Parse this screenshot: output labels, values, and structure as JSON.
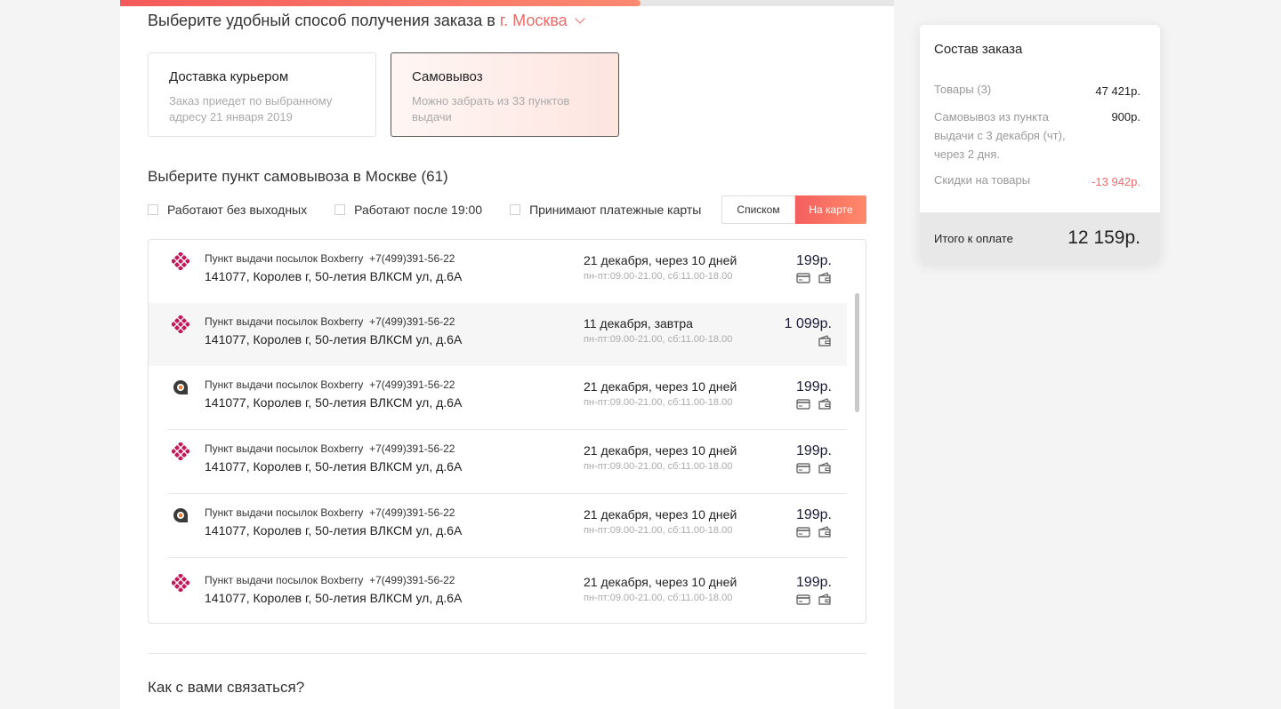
{
  "progress": {
    "fraction": 0.672
  },
  "header": {
    "prefix": "Выберите удобный способ получения заказа в",
    "city": "г. Москва"
  },
  "delivery_options": [
    {
      "title": "Доставка курьером",
      "desc": "Заказ приедет по выбранному адресу 21 января 2019",
      "selected": false
    },
    {
      "title": "Самовывоз",
      "desc": "Можно забрать из 33 пунктов выдачи",
      "selected": true
    }
  ],
  "pickup": {
    "title": "Выберите пункт самовывоза в Москве (61)",
    "filters": [
      "Работают без выходных",
      "Работают после 19:00",
      "Принимают платежные карты"
    ],
    "view_list": "Списком",
    "view_map": "На карте",
    "points": [
      {
        "logo": "boxberry-logo-icon",
        "name": "Пункт выдачи посылок Boxberry",
        "phone": "+7(499)391-56-22",
        "address": "141077, Королев г, 50-летия ВЛКСМ ул, д.6А",
        "date": "21 декабря, через 10 дней",
        "hours": "пн-пт:09.00-21.00, сб:11.00-18.00",
        "price": "199р.",
        "card": true,
        "wallet": true,
        "highlighted": false
      },
      {
        "logo": "boxberry-logo-icon",
        "name": "Пункт выдачи посылок Boxberry",
        "phone": "+7(499)391-56-22",
        "address": "141077, Королев г, 50-летия ВЛКСМ ул, д.6А",
        "date": "11 декабря, завтра",
        "hours": "пн-пт:09.00-21.00, сб:11.00-18.00",
        "price": "1 099р.",
        "card": false,
        "wallet": true,
        "highlighted": true
      },
      {
        "logo": "pickpoint-logo-icon",
        "name": "Пункт выдачи посылок Boxberry",
        "phone": "+7(499)391-56-22",
        "address": "141077, Королев г, 50-летия ВЛКСМ ул, д.6А",
        "date": "21 декабря, через 10 дней",
        "hours": "пн-пт:09.00-21.00, сб:11.00-18.00",
        "price": "199р.",
        "card": true,
        "wallet": true,
        "highlighted": false
      },
      {
        "logo": "boxberry-logo-icon",
        "name": "Пункт выдачи посылок Boxberry",
        "phone": "+7(499)391-56-22",
        "address": "141077, Королев г, 50-летия ВЛКСМ ул, д.6А",
        "date": "21 декабря, через 10 дней",
        "hours": "пн-пт:09.00-21.00, сб:11.00-18.00",
        "price": "199р.",
        "card": true,
        "wallet": true,
        "highlighted": false
      },
      {
        "logo": "pickpoint-logo-icon",
        "name": "Пункт выдачи посылок Boxberry",
        "phone": "+7(499)391-56-22",
        "address": "141077, Королев г, 50-летия ВЛКСМ ул, д.6А",
        "date": "21 декабря, через 10 дней",
        "hours": "пн-пт:09.00-21.00, сб:11.00-18.00",
        "price": "199р.",
        "card": true,
        "wallet": true,
        "highlighted": false
      },
      {
        "logo": "boxberry-logo-icon",
        "name": "Пункт выдачи посылок Boxberry",
        "phone": "+7(499)391-56-22",
        "address": "141077, Королев г, 50-летия ВЛКСМ ул, д.6А",
        "date": "21 декабря, через 10 дней",
        "hours": "пн-пт:09.00-21.00, сб:11.00-18.00",
        "price": "199р.",
        "card": true,
        "wallet": true,
        "highlighted": false
      }
    ]
  },
  "contact": {
    "title": "Как с вами связаться?"
  },
  "summary": {
    "title": "Состав заказа",
    "lines": [
      {
        "label": "Товары (3)",
        "value": "47 421р.",
        "negative": false
      },
      {
        "label": "Самовывоз из пункта выдачи с 3 декабря (чт), через 2 дня.",
        "value": "900р.",
        "negative": false
      },
      {
        "label": "Скидки на товары",
        "value": "-13 942р.",
        "negative": true
      }
    ],
    "total_label": "Итого к оплате",
    "total_value": "12 159р."
  },
  "colors": {
    "accent": "#f26a6a",
    "accent_gradient_end": "#ff8a6a",
    "boxberry": "#c2185b",
    "pickpoint": "#3a3a3a"
  }
}
